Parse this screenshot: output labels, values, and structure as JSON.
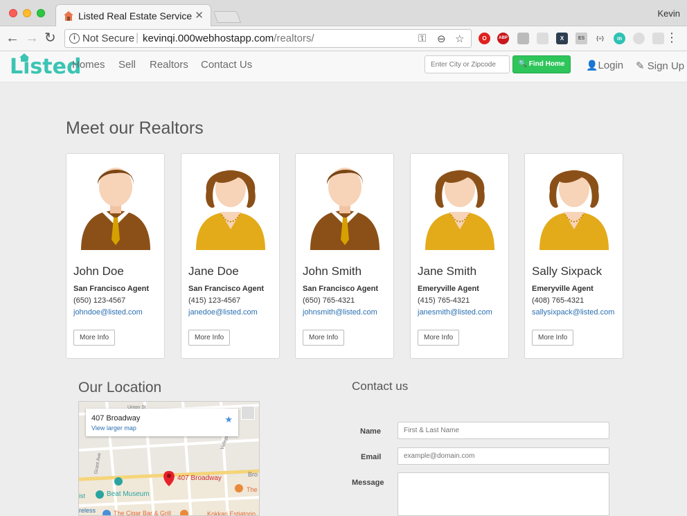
{
  "browser": {
    "tab_title": "Listed Real Estate Service",
    "tab_close": "✕",
    "profile": "Kevin",
    "not_secure": "Not Secure",
    "url_host": "kevinqi.000webhostapp.com",
    "url_path": "/realtors/",
    "extensions": [
      "O",
      "ABP",
      "",
      "",
      "X",
      "ES",
      "{≡}",
      "m",
      "",
      ""
    ]
  },
  "site": {
    "logo": "Listed",
    "nav": [
      "Homes",
      "Sell",
      "Realtors",
      "Contact Us"
    ],
    "search_placeholder": "Enter City or Zipcode",
    "find_button": "Find Home",
    "login": "Login",
    "signup": "Sign Up"
  },
  "realtors": {
    "title": "Meet our Realtors",
    "more_label": "More Info",
    "agents": [
      {
        "name": "John Doe",
        "role": "San Francisco Agent",
        "phone": "(650) 123-4567",
        "email": "johndoe@listed.com",
        "gender": "male"
      },
      {
        "name": "Jane Doe",
        "role": "San Francisco Agent",
        "phone": "(415) 123-4567",
        "email": "janedoe@listed.com",
        "gender": "female"
      },
      {
        "name": "John Smith",
        "role": "San Francisco Agent",
        "phone": "(650) 765-4321",
        "email": "johnsmith@listed.com",
        "gender": "male"
      },
      {
        "name": "Jane Smith",
        "role": "Emeryville Agent",
        "phone": "(415) 765-4321",
        "email": "janesmith@listed.com",
        "gender": "female"
      },
      {
        "name": "Sally Sixpack",
        "role": "Emeryville Agent",
        "phone": "(408) 765-4321",
        "email": "sallysixpack@listed.com",
        "gender": "female"
      }
    ]
  },
  "location": {
    "title": "Our Location",
    "address": "407 Broadway",
    "map_link": "View larger map",
    "pin_label": "407 Broadway",
    "map_labels": [
      "Union St",
      "Vallejo St",
      "Grant Ave",
      "Beat Museum",
      "The Cigar Bar & Grill",
      "Kokkari Estiatorio",
      "Broadway",
      "The",
      "Wireless",
      "ist"
    ]
  },
  "contact": {
    "title": "Contact us",
    "name_label": "Name",
    "name_placeholder": "First & Last Name",
    "email_label": "Email",
    "email_placeholder": "example@domain.com",
    "message_label": "Message"
  },
  "colors": {
    "brand": "#3bc4b3",
    "find_button": "#2ec55b",
    "link": "#2a6fb0"
  }
}
